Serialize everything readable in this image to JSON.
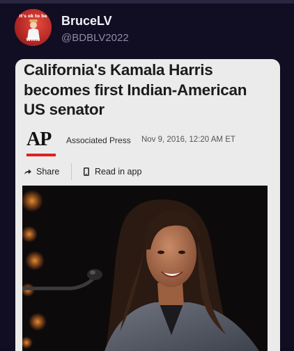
{
  "post": {
    "display_name": "BruceLV",
    "handle": "@BDBLV2022",
    "avatar": {
      "top_text": "It's ok to be",
      "bottom_text": "White"
    }
  },
  "article": {
    "headline_lines": [
      "California's Kamala Harris",
      "becomes first Indian-American",
      "US senator"
    ],
    "logo": "AP",
    "source": "Associated Press",
    "dateline": "Nov 9, 2016, 12:20 AM ET",
    "actions": {
      "share_label": "Share",
      "read_label": "Read in app"
    }
  },
  "icons": [
    "share-arrow-icon",
    "phone-icon"
  ],
  "colors": {
    "background": "#110d22",
    "card": "#ebebeb",
    "ap_accent": "#e02020"
  }
}
